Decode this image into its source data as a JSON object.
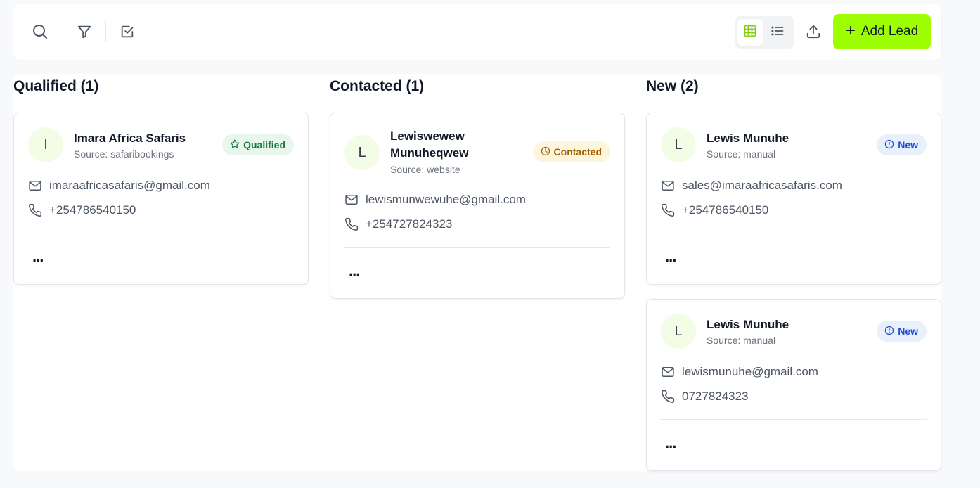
{
  "toolbar": {
    "add_lead_label": "Add Lead",
    "add_lead_icon": "+",
    "accent_color": "#9dff00"
  },
  "columns": [
    {
      "title": "Qualified (1)",
      "cards": [
        {
          "initial": "I",
          "name": "Imara Africa Safaris",
          "source": "Source: safaribookings",
          "status": "Qualified",
          "email": "imaraafricasafaris@gmail.com",
          "phone": "+254786540150",
          "more": "..."
        }
      ]
    },
    {
      "title": "Contacted (1)",
      "cards": [
        {
          "initial": "L",
          "name": "Lewiswewew Munuheqwew",
          "source": "Source: website",
          "status": "Contacted",
          "email": "lewismunwewuhe@gmail.com",
          "phone": "+254727824323",
          "more": "..."
        }
      ]
    },
    {
      "title": "New (2)",
      "cards": [
        {
          "initial": "L",
          "name": "Lewis Munuhe",
          "source": "Source: manual",
          "status": "New",
          "email": "sales@imaraafricasafaris.com",
          "phone": "+254786540150",
          "more": "..."
        },
        {
          "initial": "L",
          "name": "Lewis Munuhe",
          "source": "Source: manual",
          "status": "New",
          "email": "lewismunuhe@gmail.com",
          "phone": "0727824323",
          "more": "..."
        }
      ]
    }
  ]
}
